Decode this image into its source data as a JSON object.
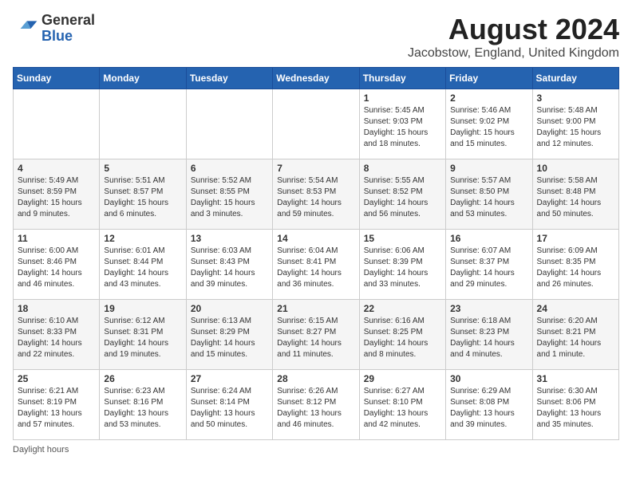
{
  "header": {
    "logo_general": "General",
    "logo_blue": "Blue",
    "month_title": "August 2024",
    "location": "Jacobstow, England, United Kingdom"
  },
  "days_of_week": [
    "Sunday",
    "Monday",
    "Tuesday",
    "Wednesday",
    "Thursday",
    "Friday",
    "Saturday"
  ],
  "weeks": [
    [
      {
        "day": "",
        "info": ""
      },
      {
        "day": "",
        "info": ""
      },
      {
        "day": "",
        "info": ""
      },
      {
        "day": "",
        "info": ""
      },
      {
        "day": "1",
        "info": "Sunrise: 5:45 AM\nSunset: 9:03 PM\nDaylight: 15 hours\nand 18 minutes."
      },
      {
        "day": "2",
        "info": "Sunrise: 5:46 AM\nSunset: 9:02 PM\nDaylight: 15 hours\nand 15 minutes."
      },
      {
        "day": "3",
        "info": "Sunrise: 5:48 AM\nSunset: 9:00 PM\nDaylight: 15 hours\nand 12 minutes."
      }
    ],
    [
      {
        "day": "4",
        "info": "Sunrise: 5:49 AM\nSunset: 8:59 PM\nDaylight: 15 hours\nand 9 minutes."
      },
      {
        "day": "5",
        "info": "Sunrise: 5:51 AM\nSunset: 8:57 PM\nDaylight: 15 hours\nand 6 minutes."
      },
      {
        "day": "6",
        "info": "Sunrise: 5:52 AM\nSunset: 8:55 PM\nDaylight: 15 hours\nand 3 minutes."
      },
      {
        "day": "7",
        "info": "Sunrise: 5:54 AM\nSunset: 8:53 PM\nDaylight: 14 hours\nand 59 minutes."
      },
      {
        "day": "8",
        "info": "Sunrise: 5:55 AM\nSunset: 8:52 PM\nDaylight: 14 hours\nand 56 minutes."
      },
      {
        "day": "9",
        "info": "Sunrise: 5:57 AM\nSunset: 8:50 PM\nDaylight: 14 hours\nand 53 minutes."
      },
      {
        "day": "10",
        "info": "Sunrise: 5:58 AM\nSunset: 8:48 PM\nDaylight: 14 hours\nand 50 minutes."
      }
    ],
    [
      {
        "day": "11",
        "info": "Sunrise: 6:00 AM\nSunset: 8:46 PM\nDaylight: 14 hours\nand 46 minutes."
      },
      {
        "day": "12",
        "info": "Sunrise: 6:01 AM\nSunset: 8:44 PM\nDaylight: 14 hours\nand 43 minutes."
      },
      {
        "day": "13",
        "info": "Sunrise: 6:03 AM\nSunset: 8:43 PM\nDaylight: 14 hours\nand 39 minutes."
      },
      {
        "day": "14",
        "info": "Sunrise: 6:04 AM\nSunset: 8:41 PM\nDaylight: 14 hours\nand 36 minutes."
      },
      {
        "day": "15",
        "info": "Sunrise: 6:06 AM\nSunset: 8:39 PM\nDaylight: 14 hours\nand 33 minutes."
      },
      {
        "day": "16",
        "info": "Sunrise: 6:07 AM\nSunset: 8:37 PM\nDaylight: 14 hours\nand 29 minutes."
      },
      {
        "day": "17",
        "info": "Sunrise: 6:09 AM\nSunset: 8:35 PM\nDaylight: 14 hours\nand 26 minutes."
      }
    ],
    [
      {
        "day": "18",
        "info": "Sunrise: 6:10 AM\nSunset: 8:33 PM\nDaylight: 14 hours\nand 22 minutes."
      },
      {
        "day": "19",
        "info": "Sunrise: 6:12 AM\nSunset: 8:31 PM\nDaylight: 14 hours\nand 19 minutes."
      },
      {
        "day": "20",
        "info": "Sunrise: 6:13 AM\nSunset: 8:29 PM\nDaylight: 14 hours\nand 15 minutes."
      },
      {
        "day": "21",
        "info": "Sunrise: 6:15 AM\nSunset: 8:27 PM\nDaylight: 14 hours\nand 11 minutes."
      },
      {
        "day": "22",
        "info": "Sunrise: 6:16 AM\nSunset: 8:25 PM\nDaylight: 14 hours\nand 8 minutes."
      },
      {
        "day": "23",
        "info": "Sunrise: 6:18 AM\nSunset: 8:23 PM\nDaylight: 14 hours\nand 4 minutes."
      },
      {
        "day": "24",
        "info": "Sunrise: 6:20 AM\nSunset: 8:21 PM\nDaylight: 14 hours\nand 1 minute."
      }
    ],
    [
      {
        "day": "25",
        "info": "Sunrise: 6:21 AM\nSunset: 8:19 PM\nDaylight: 13 hours\nand 57 minutes."
      },
      {
        "day": "26",
        "info": "Sunrise: 6:23 AM\nSunset: 8:16 PM\nDaylight: 13 hours\nand 53 minutes."
      },
      {
        "day": "27",
        "info": "Sunrise: 6:24 AM\nSunset: 8:14 PM\nDaylight: 13 hours\nand 50 minutes."
      },
      {
        "day": "28",
        "info": "Sunrise: 6:26 AM\nSunset: 8:12 PM\nDaylight: 13 hours\nand 46 minutes."
      },
      {
        "day": "29",
        "info": "Sunrise: 6:27 AM\nSunset: 8:10 PM\nDaylight: 13 hours\nand 42 minutes."
      },
      {
        "day": "30",
        "info": "Sunrise: 6:29 AM\nSunset: 8:08 PM\nDaylight: 13 hours\nand 39 minutes."
      },
      {
        "day": "31",
        "info": "Sunrise: 6:30 AM\nSunset: 8:06 PM\nDaylight: 13 hours\nand 35 minutes."
      }
    ]
  ],
  "footer": {
    "daylight_label": "Daylight hours"
  }
}
